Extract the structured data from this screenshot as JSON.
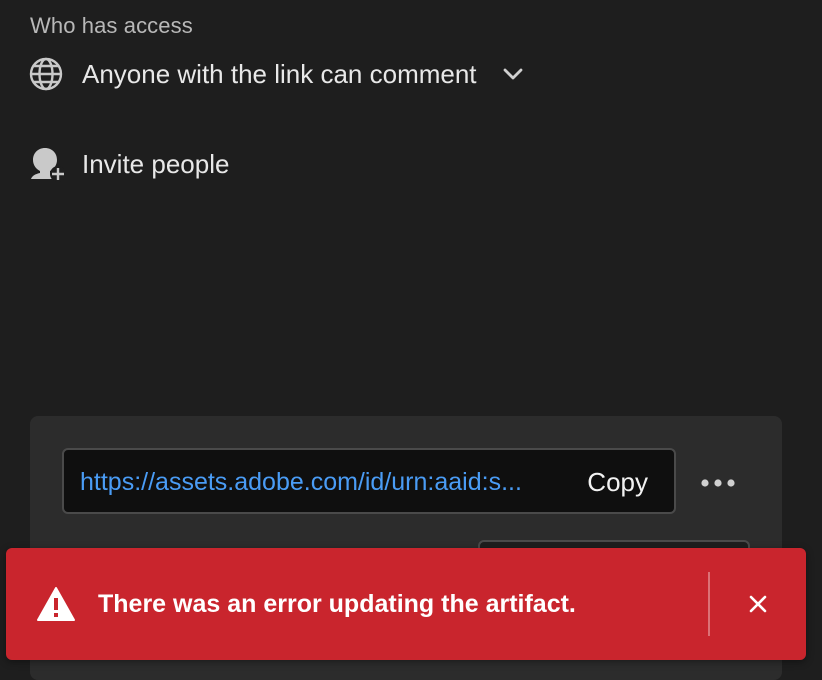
{
  "access_section": {
    "label": "Who has access",
    "current_access": "Anyone with the link can comment",
    "access_icon": "globe-icon",
    "dropdown_icon": "chevron-down-icon"
  },
  "invite": {
    "label": "Invite people",
    "icon": "add-person-icon"
  },
  "share_link": {
    "url": "https://assets.adobe.com/id/urn:aaid:s...",
    "copy_label": "Copy",
    "more_icon": "more-horizontal-icon"
  },
  "toast": {
    "message": "There was an error updating the artifact.",
    "icon": "alert-triangle-icon",
    "close_icon": "close-icon",
    "color": "#c9252d"
  },
  "colors": {
    "background": "#1e1e1e",
    "panel": "#2c2c2c",
    "link": "#4a9cf5",
    "error": "#c9252d"
  }
}
